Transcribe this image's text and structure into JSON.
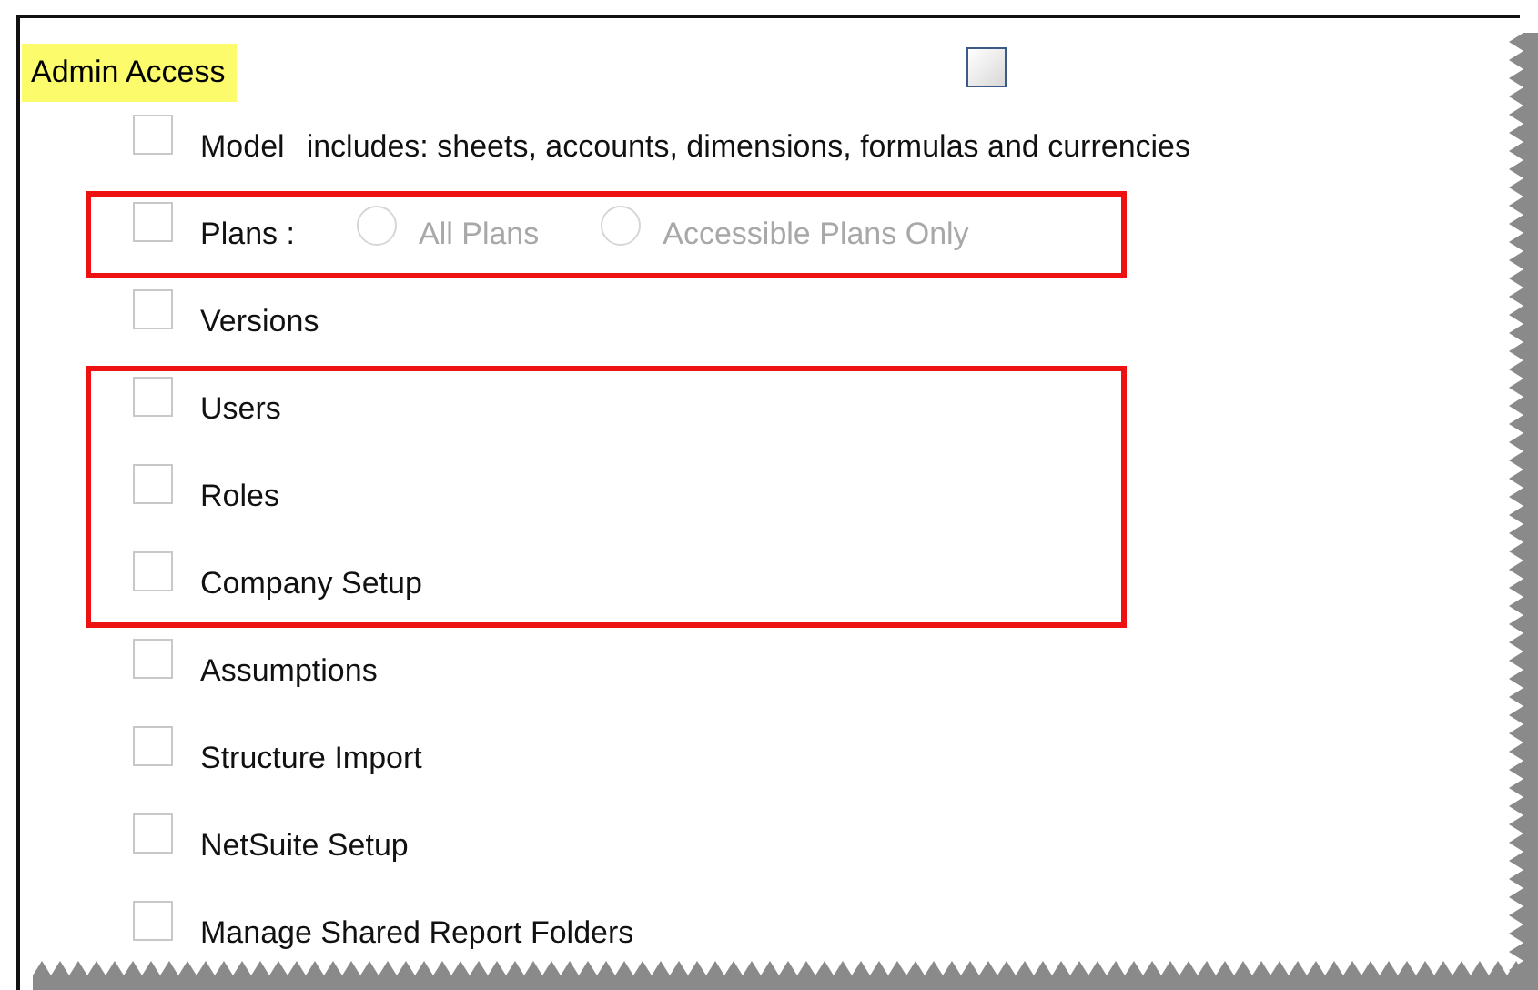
{
  "header": {
    "label": "Admin Access",
    "checked": false
  },
  "sections": [
    {
      "highlighted": false,
      "items": [
        {
          "kind": "checkbox",
          "label": "Model",
          "note": "includes: sheets, accounts, dimensions, formulas and currencies",
          "checked": false
        }
      ]
    },
    {
      "highlighted": true,
      "items": [
        {
          "kind": "radio-choice",
          "label": "Plans :",
          "checked": false,
          "options": [
            {
              "label": "All Plans",
              "selected": false,
              "disabled": true
            },
            {
              "label": "Accessible Plans Only",
              "selected": false,
              "disabled": true
            }
          ]
        }
      ]
    },
    {
      "highlighted": false,
      "items": [
        {
          "kind": "checkbox",
          "label": "Versions",
          "checked": false
        }
      ]
    },
    {
      "highlighted": true,
      "items": [
        {
          "kind": "checkbox",
          "label": "Users",
          "checked": false
        },
        {
          "kind": "checkbox",
          "label": "Roles",
          "checked": false
        },
        {
          "kind": "checkbox",
          "label": "Company Setup",
          "checked": false
        }
      ]
    },
    {
      "highlighted": false,
      "items": [
        {
          "kind": "checkbox",
          "label": "Assumptions",
          "checked": false
        },
        {
          "kind": "checkbox",
          "label": "Structure Import",
          "checked": false
        },
        {
          "kind": "checkbox",
          "label": "NetSuite Setup",
          "checked": false
        },
        {
          "kind": "checkbox",
          "label": "Manage Shared Report Folders",
          "checked": false
        }
      ]
    }
  ]
}
